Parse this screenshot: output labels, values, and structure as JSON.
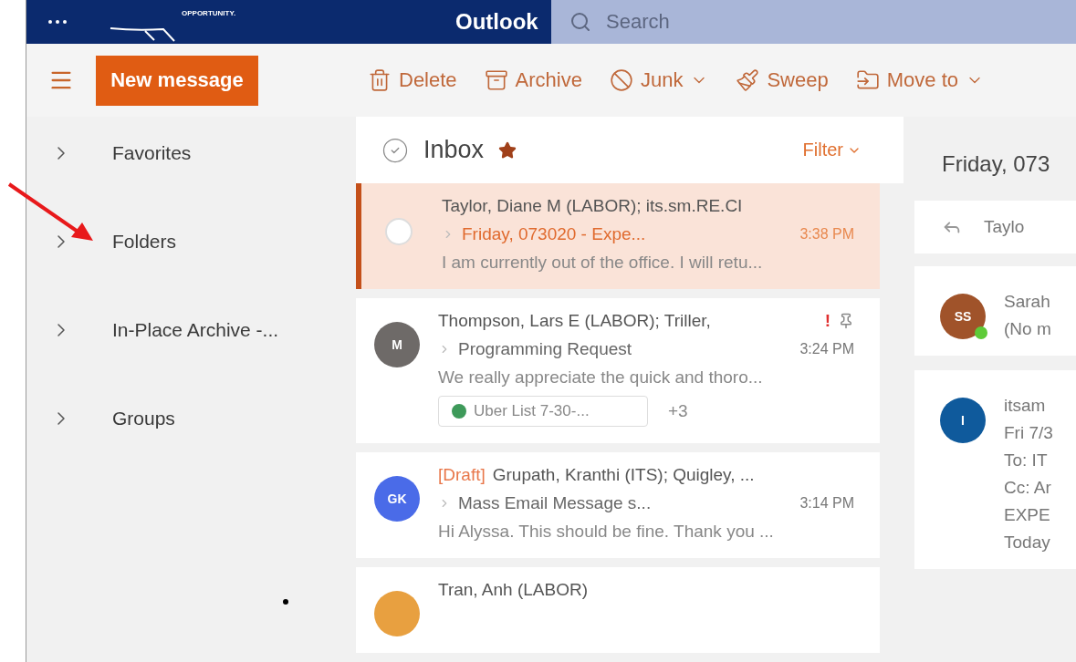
{
  "top_bar": {
    "logo_text": "OPPORTUNITY.",
    "app_name": "Outlook",
    "search": {
      "placeholder": "Search"
    }
  },
  "toolbar": {
    "new_message": "New message",
    "actions": [
      {
        "kind": "delete",
        "label": "Delete",
        "dropdown": false
      },
      {
        "kind": "archive",
        "label": "Archive",
        "dropdown": false
      },
      {
        "kind": "junk",
        "label": "Junk",
        "dropdown": true
      },
      {
        "kind": "sweep",
        "label": "Sweep",
        "dropdown": false
      },
      {
        "kind": "move",
        "label": "Move to",
        "dropdown": true
      }
    ]
  },
  "sidebar": {
    "items": [
      {
        "label": "Favorites",
        "expanded": false
      },
      {
        "label": "Folders",
        "expanded": false
      },
      {
        "label": "In-Place Archive -...",
        "expanded": false
      },
      {
        "label": "Groups",
        "expanded": false
      }
    ]
  },
  "mail_list": {
    "title": "Inbox",
    "favorite": true,
    "filter": "Filter",
    "messages": [
      {
        "selected": true,
        "sender": "Taylor, Diane M (LABOR); its.sm.RE.CI",
        "subject": "Friday, 073020 - Expe...",
        "time": "3:38 PM",
        "preview": "I am currently out of the office. I will retu...",
        "pinned": false
      },
      {
        "selected": false,
        "initials": "M",
        "color": "#6e6a68",
        "sender": "Thompson, Lars E (LABOR); Triller,",
        "flag": "!",
        "subject": "Programming Request",
        "time": "3:24 PM",
        "preview": "We really appreciate the quick and thoro...",
        "pinned": true,
        "attachment": "Uber List 7-30-...",
        "more": "+3"
      },
      {
        "selected": false,
        "initials": "GK",
        "color": "#4a6be8",
        "prefix": "[Draft]",
        "sender": "Grupath, Kranthi (ITS); Quigley, ...",
        "subject": "Mass Email Message s...",
        "time": "3:14 PM",
        "preview": "Hi Alyssa. This should be fine. Thank you ...",
        "pinned": false
      },
      {
        "selected": false,
        "color": "#e8a040",
        "sender": "Tran, Anh (LABOR)",
        "pinned": false
      }
    ]
  },
  "reading_pane": {
    "title": "Friday, 073",
    "sender_row": "Taylo",
    "messages": [
      {
        "initials": "SS",
        "color": "#a0532a",
        "online": true,
        "lines": [
          "Sarah",
          "(No m"
        ]
      },
      {
        "initials": "I",
        "color": "#0f5a9c",
        "online": false,
        "lines": [
          "itsam",
          "Fri 7/3",
          "To: IT",
          "Cc: Ar",
          "EXPE",
          "Today"
        ]
      }
    ]
  }
}
